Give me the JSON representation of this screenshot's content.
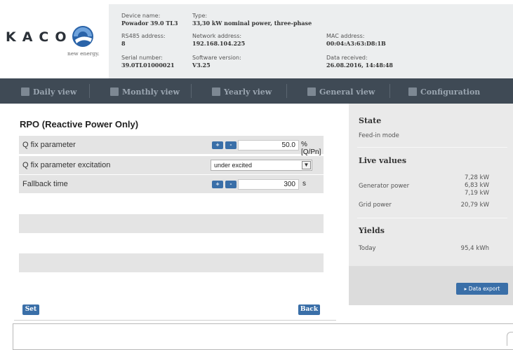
{
  "header": {
    "logo": {
      "text": "KACO",
      "tagline": "new energy."
    },
    "info": {
      "device_name": {
        "label": "Device name:",
        "value": "Powador 39.0 TL3"
      },
      "type": {
        "label": "Type:",
        "value": "33,30 kW nominal power, three-phase"
      },
      "rs485": {
        "label": "RS485 address:",
        "value": "8"
      },
      "network": {
        "label": "Network address:",
        "value": "192.168.104.225"
      },
      "mac": {
        "label": "MAC address:",
        "value": "00:04:A3:63:D8:1B"
      },
      "serial": {
        "label": "Serial number:",
        "value": "39.0TL01000021"
      },
      "software": {
        "label": "Software version:",
        "value": "V3.25"
      },
      "received": {
        "label": "Data received:",
        "value": "26.08.2016, 14:48:48"
      }
    }
  },
  "nav": {
    "items": [
      {
        "label": "Daily view",
        "icon": "daily-view-icon"
      },
      {
        "label": "Monthly view",
        "icon": "monthly-view-icon"
      },
      {
        "label": "Yearly view",
        "icon": "yearly-view-icon"
      },
      {
        "label": "General view",
        "icon": "general-view-icon"
      },
      {
        "label": "Configuration",
        "icon": "wrench-icon"
      }
    ]
  },
  "form": {
    "title": "RPO (Reactive Power Only)",
    "plus_label": "+",
    "minus_label": "-",
    "rows": [
      {
        "label": "Q fix parameter",
        "value": "50.0",
        "unit": "%[Q/Pn]"
      },
      {
        "label": "Q fix parameter excitation",
        "selected": "under excited"
      },
      {
        "label": "Fallback time",
        "value": "300",
        "unit": "s"
      }
    ],
    "set_label": "Set",
    "back_label": "Back"
  },
  "sidebar": {
    "state": {
      "heading": "State",
      "text": "Feed-in mode"
    },
    "live": {
      "heading": "Live values",
      "generator_label": "Generator power",
      "generator_values": [
        "7,28 kW",
        "6,83 kW",
        "7,19 kW"
      ],
      "grid_label": "Grid power",
      "grid_value": "20,79 kW"
    },
    "yields": {
      "heading": "Yields",
      "today_label": "Today",
      "today_value": "95,4 kWh"
    },
    "export_label": "Data export"
  },
  "colors": {
    "navbar": "#3f4a55",
    "accent": "#3a6fa8",
    "row_bg": "#e4e4e4",
    "sidebar_bg": "#eaeaea",
    "logo_blue": "#2a63a8"
  }
}
